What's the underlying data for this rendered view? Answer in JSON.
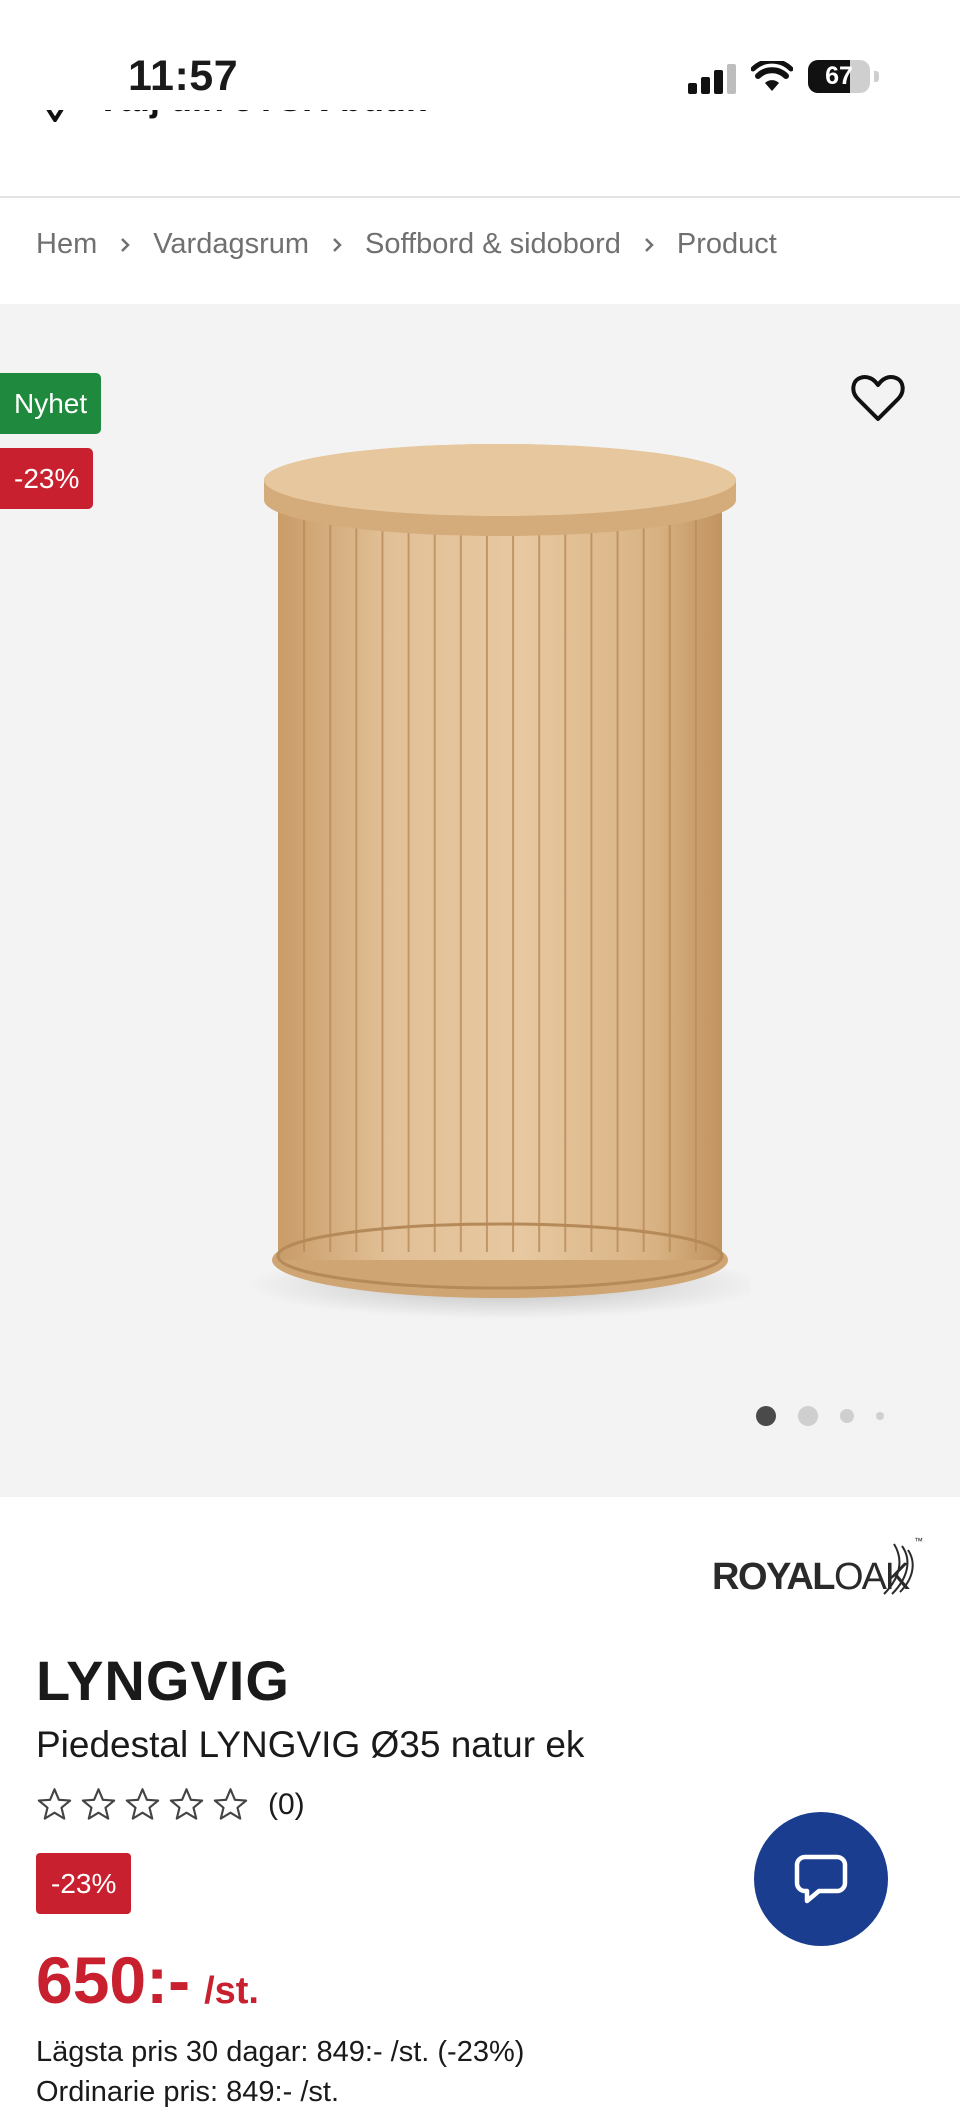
{
  "status_bar": {
    "time": "11:57",
    "battery_level": "67",
    "battery_fraction": 0.67,
    "icons": [
      "cellular-signal-icon",
      "wifi-icon",
      "battery-icon"
    ]
  },
  "store_selector": {
    "label": "Välj din JYSK-butik",
    "icons": [
      "location-pin-icon",
      "chevron-down-icon"
    ]
  },
  "breadcrumb": {
    "items": [
      "Hem",
      "Vardagsrum",
      "Soffbord & sidobord",
      "Product"
    ]
  },
  "gallery": {
    "badge_new": "Nyhet",
    "badge_discount": "-23%",
    "image_count": 4,
    "active_index": 0,
    "colors": {
      "badge_new": "#1f8a3e",
      "badge_discount": "#c8202f",
      "background": "#f3f3f3"
    }
  },
  "product": {
    "brand": {
      "strong": "ROYAL",
      "light": "OAK",
      "tm": "™"
    },
    "name": "LYNGVIG",
    "description": "Piedestal LYNGVIG Ø35 natur ek",
    "rating": {
      "stars": 0,
      "max": 5,
      "count": "(0)"
    },
    "discount": "-23%",
    "price": "650:-",
    "price_unit": "/st.",
    "lowest_price": "Lägsta pris 30 dagar: 849:- /st. (-23%)",
    "ordinary_price": "Ordinarie pris: 849:- /st.",
    "colors": {
      "price": "#c8202f",
      "chat_button": "#1b3d8f"
    }
  },
  "chat": {
    "icon": "chat-bubble-icon"
  }
}
